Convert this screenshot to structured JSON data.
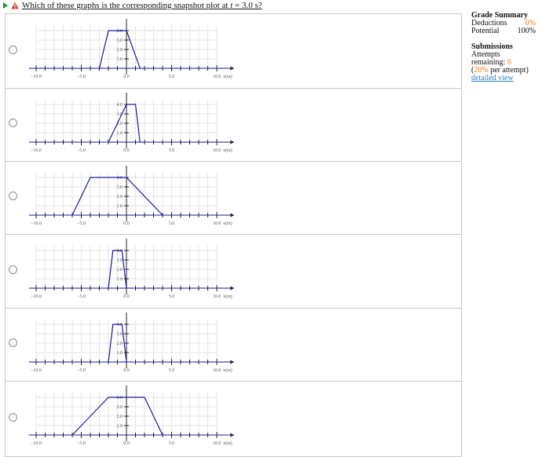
{
  "question": {
    "prefix": "Which of these graphs is the corresponding snapshot plot at ",
    "var": "t",
    "eq": " = 3.0 s?"
  },
  "graph_labels": {
    "x_ticks": [
      "−10.0",
      "−5.0",
      "0.0",
      "5.0",
      "10.0"
    ],
    "x_unit": "x(m)",
    "y_ticks": [
      "1.0",
      "2.0",
      "3.0",
      "4.0"
    ]
  },
  "options": [
    {
      "points": [
        [
          -3.0,
          0
        ],
        [
          -2.0,
          4
        ],
        [
          0.0,
          4
        ],
        [
          1.5,
          0
        ]
      ]
    },
    {
      "points": [
        [
          -2.0,
          0
        ],
        [
          0.0,
          4
        ],
        [
          1.0,
          4
        ],
        [
          1.5,
          0
        ]
      ]
    },
    {
      "points": [
        [
          -6.0,
          0
        ],
        [
          -4.0,
          4
        ],
        [
          0.0,
          4
        ],
        [
          4.0,
          0
        ]
      ]
    },
    {
      "points": [
        [
          -2.0,
          0
        ],
        [
          -1.5,
          4
        ],
        [
          -0.5,
          4
        ],
        [
          0.0,
          0
        ]
      ]
    },
    {
      "points": [
        [
          -2.0,
          0
        ],
        [
          -1.5,
          4
        ],
        [
          -0.5,
          4
        ],
        [
          0.0,
          0
        ]
      ]
    },
    {
      "points": [
        [
          -6.0,
          0
        ],
        [
          -2.0,
          4
        ],
        [
          2.0,
          4
        ],
        [
          4.0,
          0
        ]
      ]
    }
  ],
  "sidebar": {
    "grade_title": "Grade Summary",
    "deductions_label": "Deductions",
    "deductions_value": "0%",
    "potential_label": "Potential",
    "potential_value": "100%",
    "submissions_title": "Submissions",
    "attempts_label": "Attempts remaining: ",
    "attempts_value": "6",
    "penalty_value": "20%",
    "penalty_suffix": " per attempt)",
    "detailed_view": "detailed view"
  }
}
